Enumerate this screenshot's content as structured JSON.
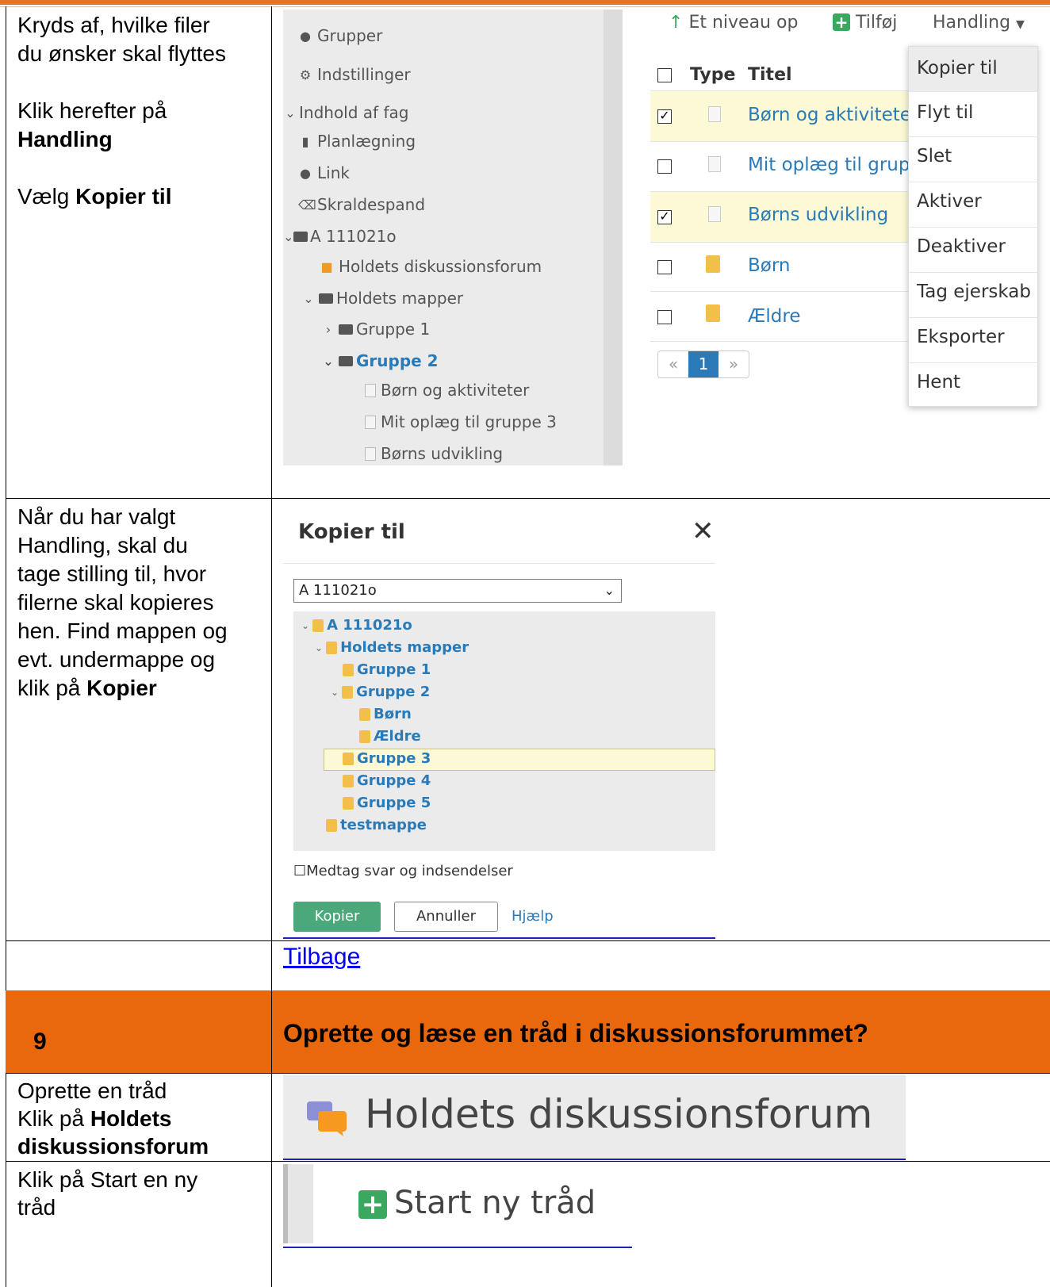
{
  "row1": {
    "instr_line1": "Kryds af, hvilke filer",
    "instr_line2": "du ønsker skal flyttes",
    "instr_line3": "Klik herefter på",
    "instr_line4_bold": "Handling",
    "instr_line5_prefix": "Vælg ",
    "instr_line5_bold": "Kopier til"
  },
  "sidebar": {
    "items": [
      {
        "label": "Grupper",
        "icon": "group-icon"
      },
      {
        "label": "Indstillinger",
        "icon": "gear-icon"
      },
      {
        "label": "Indhold af fag",
        "icon": "chevron-down-icon"
      },
      {
        "label": "Planlægning",
        "icon": "planning-icon"
      },
      {
        "label": "Link",
        "icon": "globe-icon"
      },
      {
        "label": "Skraldespand",
        "icon": "trash-icon"
      },
      {
        "label": "A 111021o",
        "icon": "folder-open-icon"
      },
      {
        "label": "Holdets diskussionsforum",
        "icon": "forum-icon"
      },
      {
        "label": "Holdets mapper",
        "icon": "folder-open-icon"
      },
      {
        "label": "Gruppe 1",
        "icon": "folder-icon"
      },
      {
        "label": "Gruppe 2",
        "icon": "folder-open-icon"
      },
      {
        "label": "Børn og aktiviteter",
        "icon": "document-icon"
      },
      {
        "label": "Mit oplæg til gruppe 3",
        "icon": "document-icon"
      },
      {
        "label": "Børns udvikling",
        "icon": "document-icon"
      }
    ]
  },
  "toolbar": {
    "up_label": "Et niveau op",
    "add_label": "Tilføj",
    "action_label": "Handling"
  },
  "file_table": {
    "col_type": "Type",
    "col_title": "Titel",
    "rows": [
      {
        "title": "Børn og aktivitete",
        "checked": true
      },
      {
        "title": "Mit oplæg til grup",
        "checked": false
      },
      {
        "title": "Børns udvikling",
        "checked": true
      },
      {
        "title": "Børn",
        "checked": false
      },
      {
        "title": "Ældre",
        "checked": false
      }
    ]
  },
  "pager": {
    "prev": "«",
    "current": "1",
    "next": "»"
  },
  "action_menu": {
    "items": [
      "Kopier til",
      "Flyt til",
      "Slet",
      "Aktiver",
      "Deaktiver",
      "Tag ejerskab",
      "Eksporter",
      "Hent"
    ]
  },
  "row2": {
    "line1": "Når du har valgt",
    "line2": "Handling, skal du",
    "line3": "tage stilling til, hvor",
    "line4": "filerne skal kopieres",
    "line5": "hen. Find mappen og",
    "line6": "evt. undermappe og",
    "line7_prefix": "klik på ",
    "line7_bold": "Kopier"
  },
  "copy_dialog": {
    "title": "Kopier til",
    "close_icon": "close-icon",
    "select_value": "A 111021o",
    "tree": [
      "A 111021o",
      "Holdets mapper",
      "Gruppe 1",
      "Gruppe 2",
      "Børn",
      "Ældre",
      "Gruppe 3",
      "Gruppe 4",
      "Gruppe 5",
      "testmappe"
    ],
    "checkbox_label": "Medtag svar og indsendelser",
    "copy_button": "Kopier",
    "cancel_button": "Annuller",
    "help_link": "Hjælp"
  },
  "back_link": "Tilbage",
  "section9": {
    "number": "9",
    "title": "Oprette og læse en tråd i diskussionsforummet?"
  },
  "row_forum": {
    "line1": "Oprette en tråd",
    "line2_prefix": "Klik på ",
    "line2_bold": "Holdets",
    "line3_bold": "diskussionsforum",
    "forum_label": "Holdets diskussionsforum"
  },
  "row_thread": {
    "line1": "Klik på Start en ny",
    "line2": "tråd",
    "button_label": "Start ny tråd"
  },
  "colors": {
    "accent_orange": "#e9680c",
    "link_blue": "#2a7ab8",
    "green": "#3aa85e",
    "highlight": "#fcf9d6"
  }
}
